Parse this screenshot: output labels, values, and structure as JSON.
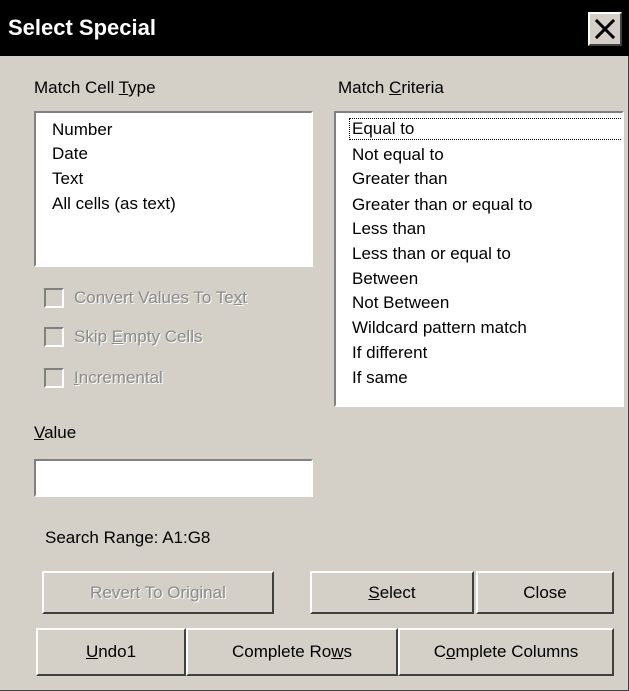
{
  "title": "Select Special",
  "icons": {
    "close": "close-icon"
  },
  "match_cell_type": {
    "label_pre": "Match Cell ",
    "label_key": "T",
    "label_post": "ype",
    "items": [
      "Number",
      "Date",
      "Text",
      "All cells (as text)"
    ]
  },
  "match_criteria": {
    "label_pre": "Match ",
    "label_key": "C",
    "label_post": "riteria",
    "items": [
      "Equal to",
      "Not equal to",
      "Greater than",
      "Greater than or equal to",
      "Less than",
      "Less than or equal to",
      "Between",
      "Not Between",
      "Wildcard pattern match",
      "If different",
      "If same"
    ],
    "selected": "Equal to"
  },
  "options": {
    "convert_pre": "Convert Values To Te",
    "convert_key": "x",
    "convert_post": "t",
    "convert_checked": false,
    "skip_pre": "Skip ",
    "skip_key": "E",
    "skip_post": "mpty Cells",
    "skip_checked": false,
    "incremental_pre": "",
    "incremental_key": "I",
    "incremental_post": "ncremental",
    "incremental_checked": false
  },
  "value_field": {
    "label_key": "V",
    "label_post": "alue",
    "value": ""
  },
  "search_range": "Search Range: A1:G8",
  "buttons": {
    "revert": "Revert To Original",
    "select_key": "S",
    "select_post": "elect",
    "close": "Close",
    "undo_key": "U",
    "undo_post": "ndo1",
    "rows_pre": "Complete Ro",
    "rows_key": "w",
    "rows_post": "s",
    "columns_pre": "C",
    "columns_key": "o",
    "columns_post": "mplete Columns"
  },
  "colors": {
    "face": "#d4d0c8",
    "title_bg": "#000000",
    "title_text": "#ffffff",
    "disabled_text": "#8a8a8a"
  }
}
